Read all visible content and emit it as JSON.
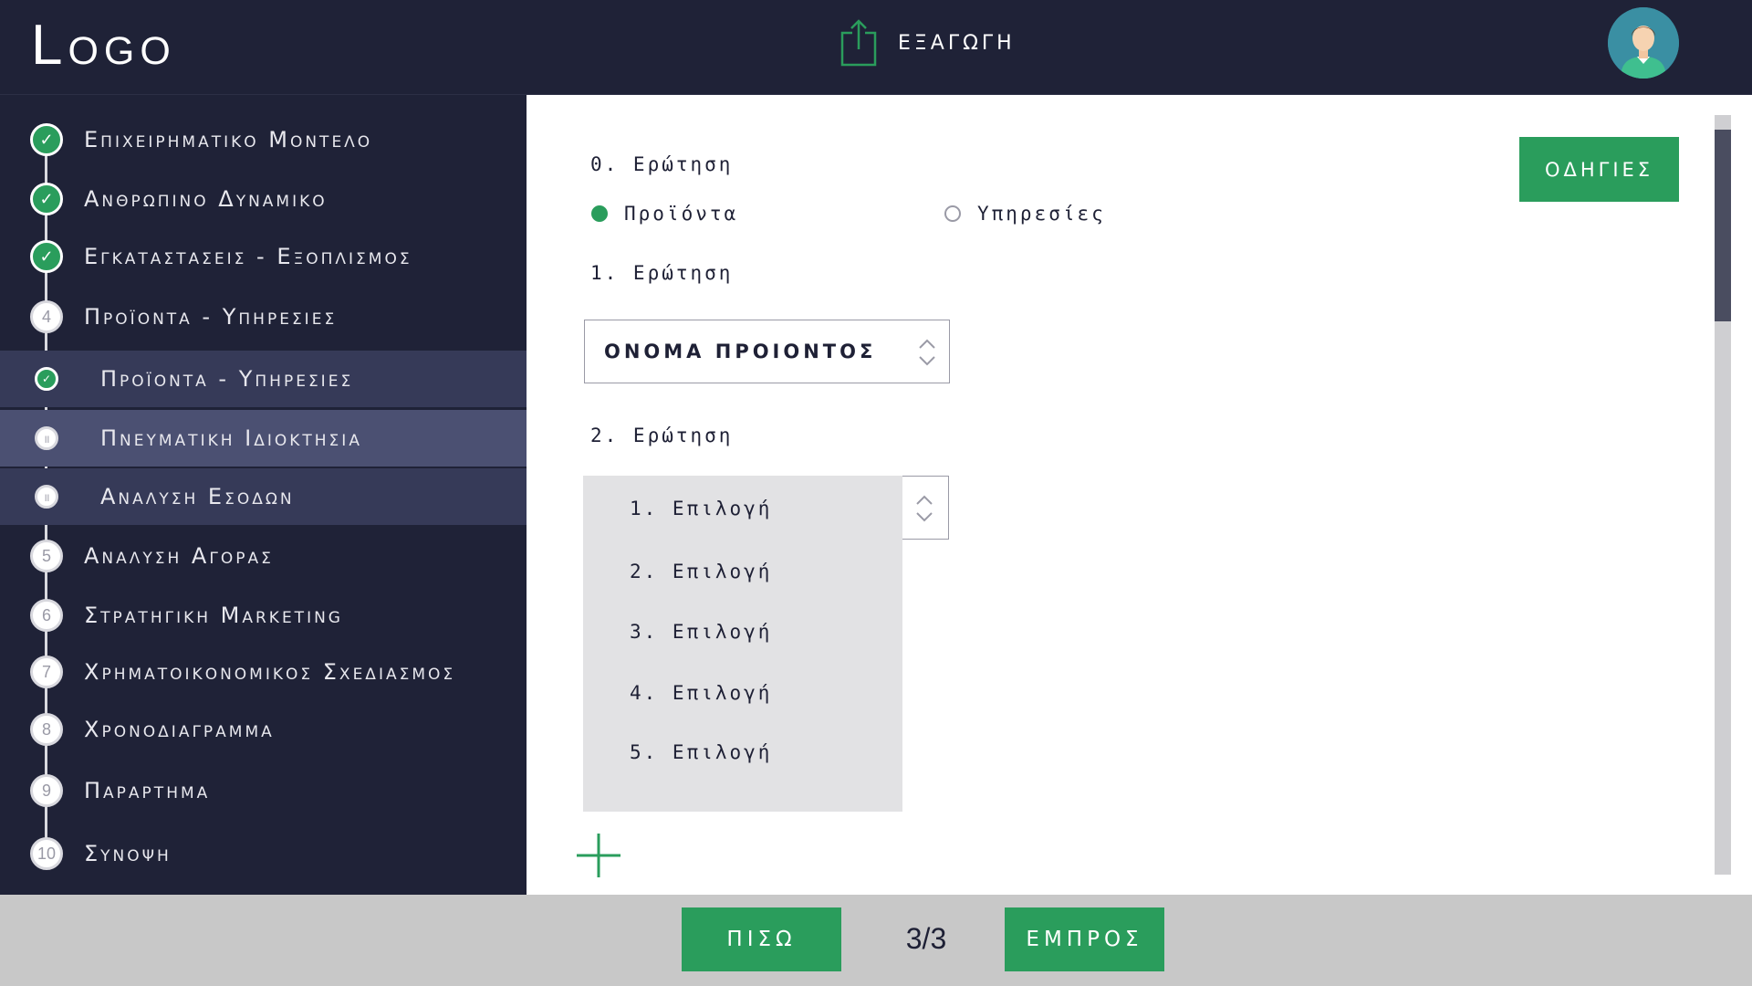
{
  "header": {
    "logo": "Logo",
    "export_label": "ΕΞΑΓΩΓΗ",
    "export_icon": "export-upload-icon",
    "avatar_icon": "user-avatar-icon"
  },
  "sidebar": {
    "items": [
      {
        "step": "✓",
        "label": "Επιχειρηματικο Μοντελο",
        "status": "done"
      },
      {
        "step": "✓",
        "label": "Ανθρωπινο Δυναμικο",
        "status": "done"
      },
      {
        "step": "✓",
        "label": "Εγκαταστασεις - Εξοπλισμος",
        "status": "done"
      },
      {
        "step": "4",
        "label": "Προϊοντα - Υπηρεσιες",
        "status": "current"
      },
      {
        "step": "✓",
        "label": "Προϊοντα - Υπηρεσιες",
        "status": "sub-done"
      },
      {
        "step": "॥",
        "label": "Πνευματικη Ιδιοκτησια",
        "status": "sub-active"
      },
      {
        "step": "॥",
        "label": "Αναλυση Εσοδων",
        "status": "sub-pending"
      },
      {
        "step": "5",
        "label": "Αναλυση Αγορας",
        "status": "pending"
      },
      {
        "step": "6",
        "label": "Στρατηγικη Marketing",
        "status": "pending"
      },
      {
        "step": "7",
        "label": "Χρηματοικονομικος Σχεδιασμος",
        "status": "pending"
      },
      {
        "step": "8",
        "label": "Χρονοδιαγραμμα",
        "status": "pending"
      },
      {
        "step": "9",
        "label": "Παραρτημα",
        "status": "pending"
      },
      {
        "step": "10",
        "label": "Συνοψη",
        "status": "pending"
      }
    ]
  },
  "main": {
    "q0": "0. Ερώτηση",
    "radio_products": "Προϊόντα",
    "radio_services": "Υπηρεσίες",
    "radio_selected": "Προϊόντα",
    "q1": "1. Ερώτηση",
    "product_name_value": "ΟΝΟΜΑ ΠΡΟΙΟΝΤΟΣ",
    "q2": "2. Ερώτηση",
    "options": [
      "1. Επιλογή",
      "2. Επιλογή",
      "3. Επιλογή",
      "4. Επιλογή",
      "5. Επιλογή"
    ],
    "instructions_label": "ΟΔΗΓΙΕΣ",
    "add_icon": "plus-icon"
  },
  "footer": {
    "back_label": "ΠΙΣΩ",
    "page_indicator": "3/3",
    "next_label": "ΕΜΠΡΟΣ"
  },
  "colors": {
    "accent": "#2a9d5c",
    "sidebar_bg": "#1f2237",
    "sub_item_bg": "#363a58",
    "sub_item_active_bg": "#4b5072",
    "footer_bg": "#c8c8c8"
  }
}
